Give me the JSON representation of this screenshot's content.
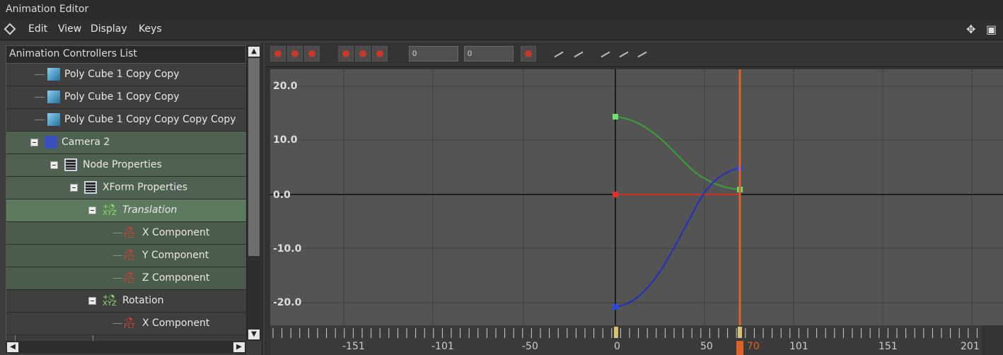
{
  "window": {
    "title": "Animation Editor"
  },
  "menu": {
    "items": [
      "Edit",
      "View",
      "Display",
      "Keys"
    ]
  },
  "controllers": {
    "header": "Animation Controllers List",
    "items": [
      "Poly Cube 1 Copy Copy",
      "Poly Cube 1 Copy Copy",
      "Poly Cube 1 Copy Copy Copy Copy",
      "Camera 2",
      "Node Properties",
      "XForm Properties",
      "Translation",
      "X Component",
      "Y Component",
      "Z Component",
      "Rotation",
      "X Component"
    ]
  },
  "toolbar": {
    "field1": "0",
    "field2": "0"
  },
  "graph": {
    "y_ticks": [
      "20.0",
      "10.0",
      "0.0",
      "-10.0",
      "-20.0"
    ],
    "x_ticks": [
      "-151",
      "-101",
      "-50",
      "0",
      "50",
      "70",
      "101",
      "151",
      "201"
    ],
    "current_frame": "70",
    "colors": {
      "x_curve": "#d03020",
      "y_curve": "#3aa03a",
      "z_curve": "#2030c0",
      "playhead": "#e0602a"
    }
  }
}
